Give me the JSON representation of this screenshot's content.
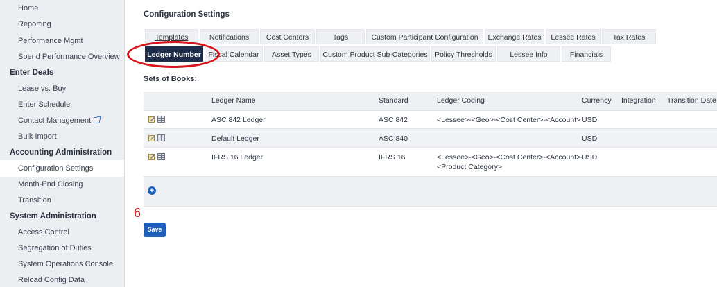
{
  "sidebar": {
    "items": [
      {
        "label": "Home"
      },
      {
        "label": "Reporting"
      },
      {
        "label": "Performance Mgmt"
      },
      {
        "label": "Spend Performance Overview"
      },
      {
        "label": "Enter Deals"
      },
      {
        "label": "Lease vs. Buy"
      },
      {
        "label": "Enter Schedule"
      },
      {
        "label": "Contact Management"
      },
      {
        "label": "Bulk Import"
      },
      {
        "label": "Accounting Administration"
      },
      {
        "label": "Configuration Settings"
      },
      {
        "label": "Month-End Closing"
      },
      {
        "label": "Transition"
      },
      {
        "label": "System Administration"
      },
      {
        "label": "Access Control"
      },
      {
        "label": "Segregation of Duties"
      },
      {
        "label": "System Operations Console"
      },
      {
        "label": "Reload Config Data"
      }
    ]
  },
  "main": {
    "title": "Configuration Settings",
    "tabs_row1": [
      {
        "label": "Templates"
      },
      {
        "label": "Notifications"
      },
      {
        "label": "Cost Centers"
      },
      {
        "label": "Tags"
      },
      {
        "label": "Custom Participant Configuration"
      },
      {
        "label": "Exchange Rates"
      },
      {
        "label": "Lessee Rates"
      },
      {
        "label": "Tax Rates"
      }
    ],
    "tabs_row2": [
      {
        "label": "Ledger Number"
      },
      {
        "label": "Fiscal Calendar"
      },
      {
        "label": "Asset Types"
      },
      {
        "label": "Custom Product Sub-Categories"
      },
      {
        "label": "Policy Thresholds"
      },
      {
        "label": "Lessee Info"
      },
      {
        "label": "Financials"
      }
    ],
    "sets_label": "Sets of Books:",
    "table": {
      "headers": [
        "Ledger Name",
        "Standard",
        "Ledger Coding",
        "Currency",
        "Integration",
        "Transition Date"
      ],
      "rows": [
        {
          "name": "ASC 842 Ledger",
          "standard": "ASC 842",
          "coding": "<Lessee>-<Geo>-<Cost Center>-<Account>",
          "coding2": "",
          "currency": "USD"
        },
        {
          "name": "Default Ledger",
          "standard": "ASC 840",
          "coding": "",
          "coding2": "",
          "currency": "USD"
        },
        {
          "name": "IFRS 16 Ledger",
          "standard": "IFRS 16",
          "coding": "<Lessee>-<Geo>-<Cost Center>-<Account>-",
          "coding2": "<Product Category>",
          "currency": "USD"
        }
      ]
    },
    "add_label": "+",
    "step_number": "6",
    "save_label": "Save"
  },
  "colors": {
    "active_tab": "#1f2d4a",
    "primary_button": "#1e5fb8",
    "annotation": "#d7141a"
  }
}
